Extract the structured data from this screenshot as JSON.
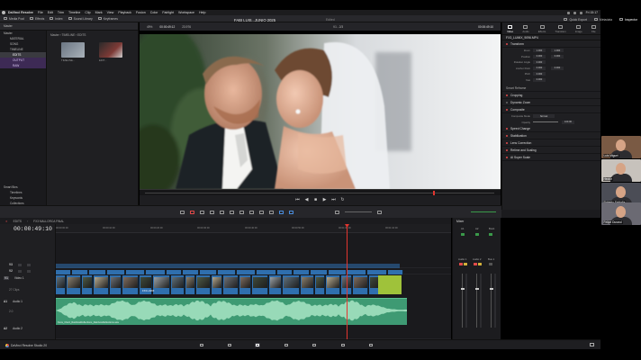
{
  "menubar": {
    "items": [
      "DaVinci Resolve",
      "File",
      "Edit",
      "Trim",
      "Timeline",
      "Clip",
      "Mark",
      "View",
      "Playback",
      "Fusion",
      "Color",
      "Fairlight",
      "Workspace",
      "Help"
    ],
    "clock": "Fri 15:17"
  },
  "toolbar": {
    "left": [
      {
        "label": "Media Pool",
        "icon": "media-pool-icon"
      },
      {
        "label": "Effects",
        "icon": "effects-icon"
      },
      {
        "label": "Index",
        "icon": "index-icon"
      },
      {
        "label": "Sound Library",
        "icon": "sound-library-icon"
      },
      {
        "label": "Keyframes",
        "icon": "keyframe-icon"
      }
    ],
    "project_title": "FABI LUIS...JUNIO 2025",
    "project_status": "Edited",
    "right": [
      {
        "label": "Quick Export",
        "icon": "export-icon"
      },
      {
        "label": "Metadata",
        "icon": "metadata-icon"
      },
      {
        "label": "Inspector",
        "icon": "inspector-icon",
        "active": true
      }
    ]
  },
  "media_pool": {
    "tools": [
      "Master",
      "TIMELINE",
      "EDITS"
    ],
    "bins": [
      {
        "label": "Master",
        "level": 1,
        "style": "normal"
      },
      {
        "label": "MATERIAL",
        "level": 2,
        "style": "normal"
      },
      {
        "label": "SONG",
        "level": 2,
        "style": "normal"
      },
      {
        "label": "TIMELINE",
        "level": 2,
        "style": "sel"
      },
      {
        "label": "EDITS",
        "level": 3,
        "style": "sel"
      },
      {
        "label": "OUTPUT",
        "level": 3,
        "style": "purple"
      },
      {
        "label": "RAW",
        "level": 3,
        "style": "purple"
      }
    ],
    "smart_bins_title": "Smart Bins",
    "smart_bins": [
      "Timelines",
      "Keywords",
      "Collections"
    ],
    "path": "Master › TIMELINE › EDITS",
    "thumbnails": [
      "TIMELINE...",
      "EDIT..."
    ]
  },
  "viewer": {
    "zoom": "49%",
    "timecode_left": "00:00:49:12",
    "fps": "23.976",
    "version": "V1 - 2/3",
    "timecode_right": "00:00:49:10",
    "header_options": [
      "Fit",
      "Timeline 1"
    ]
  },
  "inspector": {
    "tabs": [
      {
        "label": "Video",
        "active": true
      },
      {
        "label": "Audio",
        "active": false
      },
      {
        "label": "Effects",
        "active": false
      },
      {
        "label": "Transition",
        "active": false
      },
      {
        "label": "Image",
        "active": false
      },
      {
        "label": "File",
        "active": false
      }
    ],
    "clip_name": "FX3_LUMIX_9096.MP4",
    "transform_title": "Transform",
    "transform_params": [
      {
        "label": "Zoom",
        "x": "1.000",
        "y": "1.000"
      },
      {
        "label": "Position",
        "x": "0.000",
        "y": "0.000"
      },
      {
        "label": "Rotation Angle",
        "x": "0.000",
        "y": ""
      },
      {
        "label": "Anchor Point",
        "x": "0.000",
        "y": "0.000"
      },
      {
        "label": "Pitch",
        "x": "0.000",
        "y": ""
      },
      {
        "label": "Yaw",
        "x": "0.000",
        "y": ""
      }
    ],
    "smart_reframe": "Smart Reframe",
    "sections_a": [
      {
        "label": "Cropping",
        "on": true
      },
      {
        "label": "Dynamic Zoom",
        "on": true
      },
      {
        "label": "Composite",
        "on": true
      }
    ],
    "composite_mode_label": "Composite Mode",
    "composite_mode": "Normal",
    "opacity_label": "Opacity",
    "opacity": "100.00",
    "sections_b": [
      {
        "label": "Speed Change",
        "on": true
      },
      {
        "label": "Stabilization",
        "on": true
      },
      {
        "label": "Lens Correction",
        "on": true
      },
      {
        "label": "Retime and Scaling",
        "on": true
      },
      {
        "label": "AI Super Scale",
        "on": true
      }
    ]
  },
  "timeline": {
    "tabs": [
      "EDITS",
      "FX3 MALLORCA FINAL"
    ],
    "timecode": "00:00:49:10",
    "ruler": [
      "00:00:00:00",
      "00:00:10:00",
      "00:00:20:00",
      "00:00:30:00",
      "00:00:40:00",
      "00:00:50:00",
      "00:01:00:00",
      "00:01:10:00"
    ],
    "tracks": [
      {
        "id": "V3",
        "name": "",
        "info": ""
      },
      {
        "id": "V2",
        "name": "",
        "info": ""
      },
      {
        "id": "V1",
        "name": "Video 1",
        "info": "27 Clips"
      },
      {
        "id": "A1",
        "name": "Audio 1",
        "info": "2.0"
      },
      {
        "id": "A2",
        "name": "Audio 2",
        "info": ""
      }
    ],
    "zoom_label": "zoom",
    "v1_clip_label": "FX3 LUMIX",
    "audio_clip_label": "Kuns_Cheiz_RainbowReflections_RainbowReflections.wav"
  },
  "mixer": {
    "title": "Mixer",
    "strips": [
      "A1",
      "A2",
      "Bus1"
    ],
    "channels": [
      "Audio 1",
      "Audio 2",
      "Bus 1"
    ]
  },
  "dock": {
    "brand": "DaVinci Resolve Studio 20",
    "pages": [
      "media-page",
      "cut-page",
      "edit-page",
      "fusion-page",
      "color-page",
      "fairlight-page",
      "deliver-page"
    ]
  },
  "participants": [
    {
      "name": "Luis Miguel",
      "bg": "#7a5a44"
    },
    {
      "name": "Hector",
      "bg": "#c7c2bc"
    },
    {
      "name": "Roberto Saldaña",
      "bg": "#4b4d56"
    },
    {
      "name": "Felipe Durand",
      "bg": "#6b6a73"
    }
  ],
  "colors": {
    "video_clip": "#2f6fae",
    "audio_clip": "#3e9a73",
    "playhead": "#e2352f",
    "accent_purple": "#3d2a55"
  }
}
